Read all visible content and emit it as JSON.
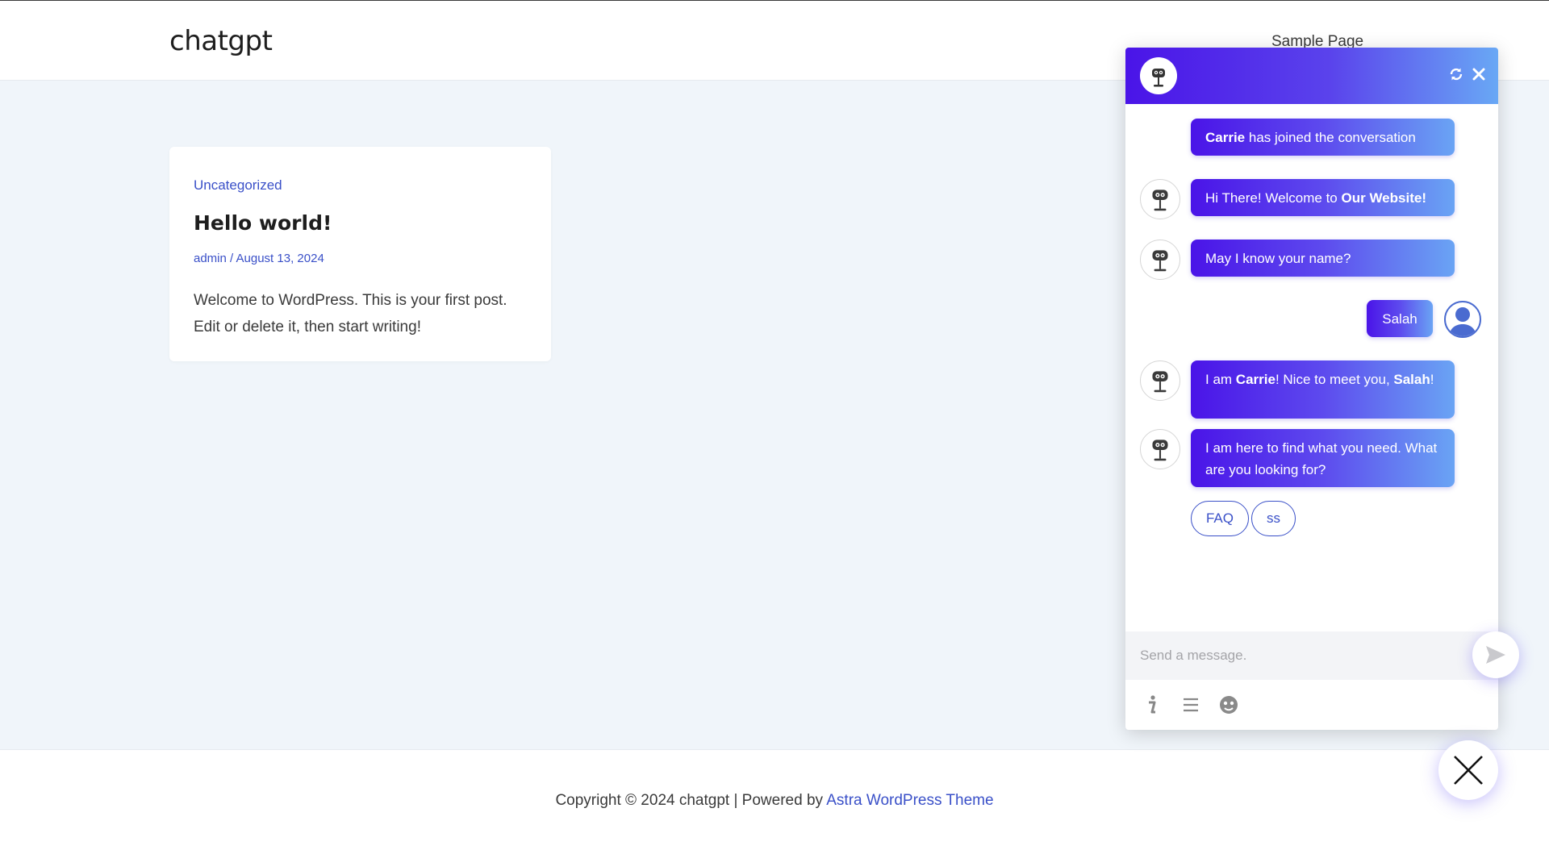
{
  "header": {
    "site_title": "chatgpt",
    "nav": [
      "Sample Page"
    ]
  },
  "post": {
    "category": "Uncategorized",
    "title": "Hello world!",
    "meta": "admin / August 13, 2024",
    "excerpt": "Welcome to WordPress. This is your first post. Edit or delete it, then start writing!"
  },
  "footer": {
    "text": "Copyright © 2024 chatgpt | Powered by ",
    "link": "Astra WordPress Theme"
  },
  "chat": {
    "header_icons": [
      "refresh-icon",
      "close-icon"
    ],
    "messages": [
      {
        "from": "system",
        "bold": "Carrie",
        "text": " has joined the conversation"
      },
      {
        "from": "bot",
        "text": "Hi There! Welcome to ",
        "bold": "Our Website!"
      },
      {
        "from": "bot",
        "text": "May I know your name?"
      },
      {
        "from": "user",
        "text": "Salah"
      },
      {
        "from": "bot",
        "pre": "I am ",
        "bold": "Carrie",
        "mid": "! Nice to meet you, ",
        "bold2": "Salah",
        "post": "!"
      },
      {
        "from": "bot",
        "text": "I am here to find what you need. What are you looking for?"
      }
    ],
    "quick_replies": [
      "FAQ",
      "ss"
    ],
    "input_placeholder": "Send a message.",
    "toolbar_icons": [
      "info-icon",
      "menu-icon",
      "emoji-icon"
    ]
  },
  "colors": {
    "gradient_start": "#4a14e8",
    "gradient_end": "#69a8f5",
    "link": "#3a50c8"
  }
}
